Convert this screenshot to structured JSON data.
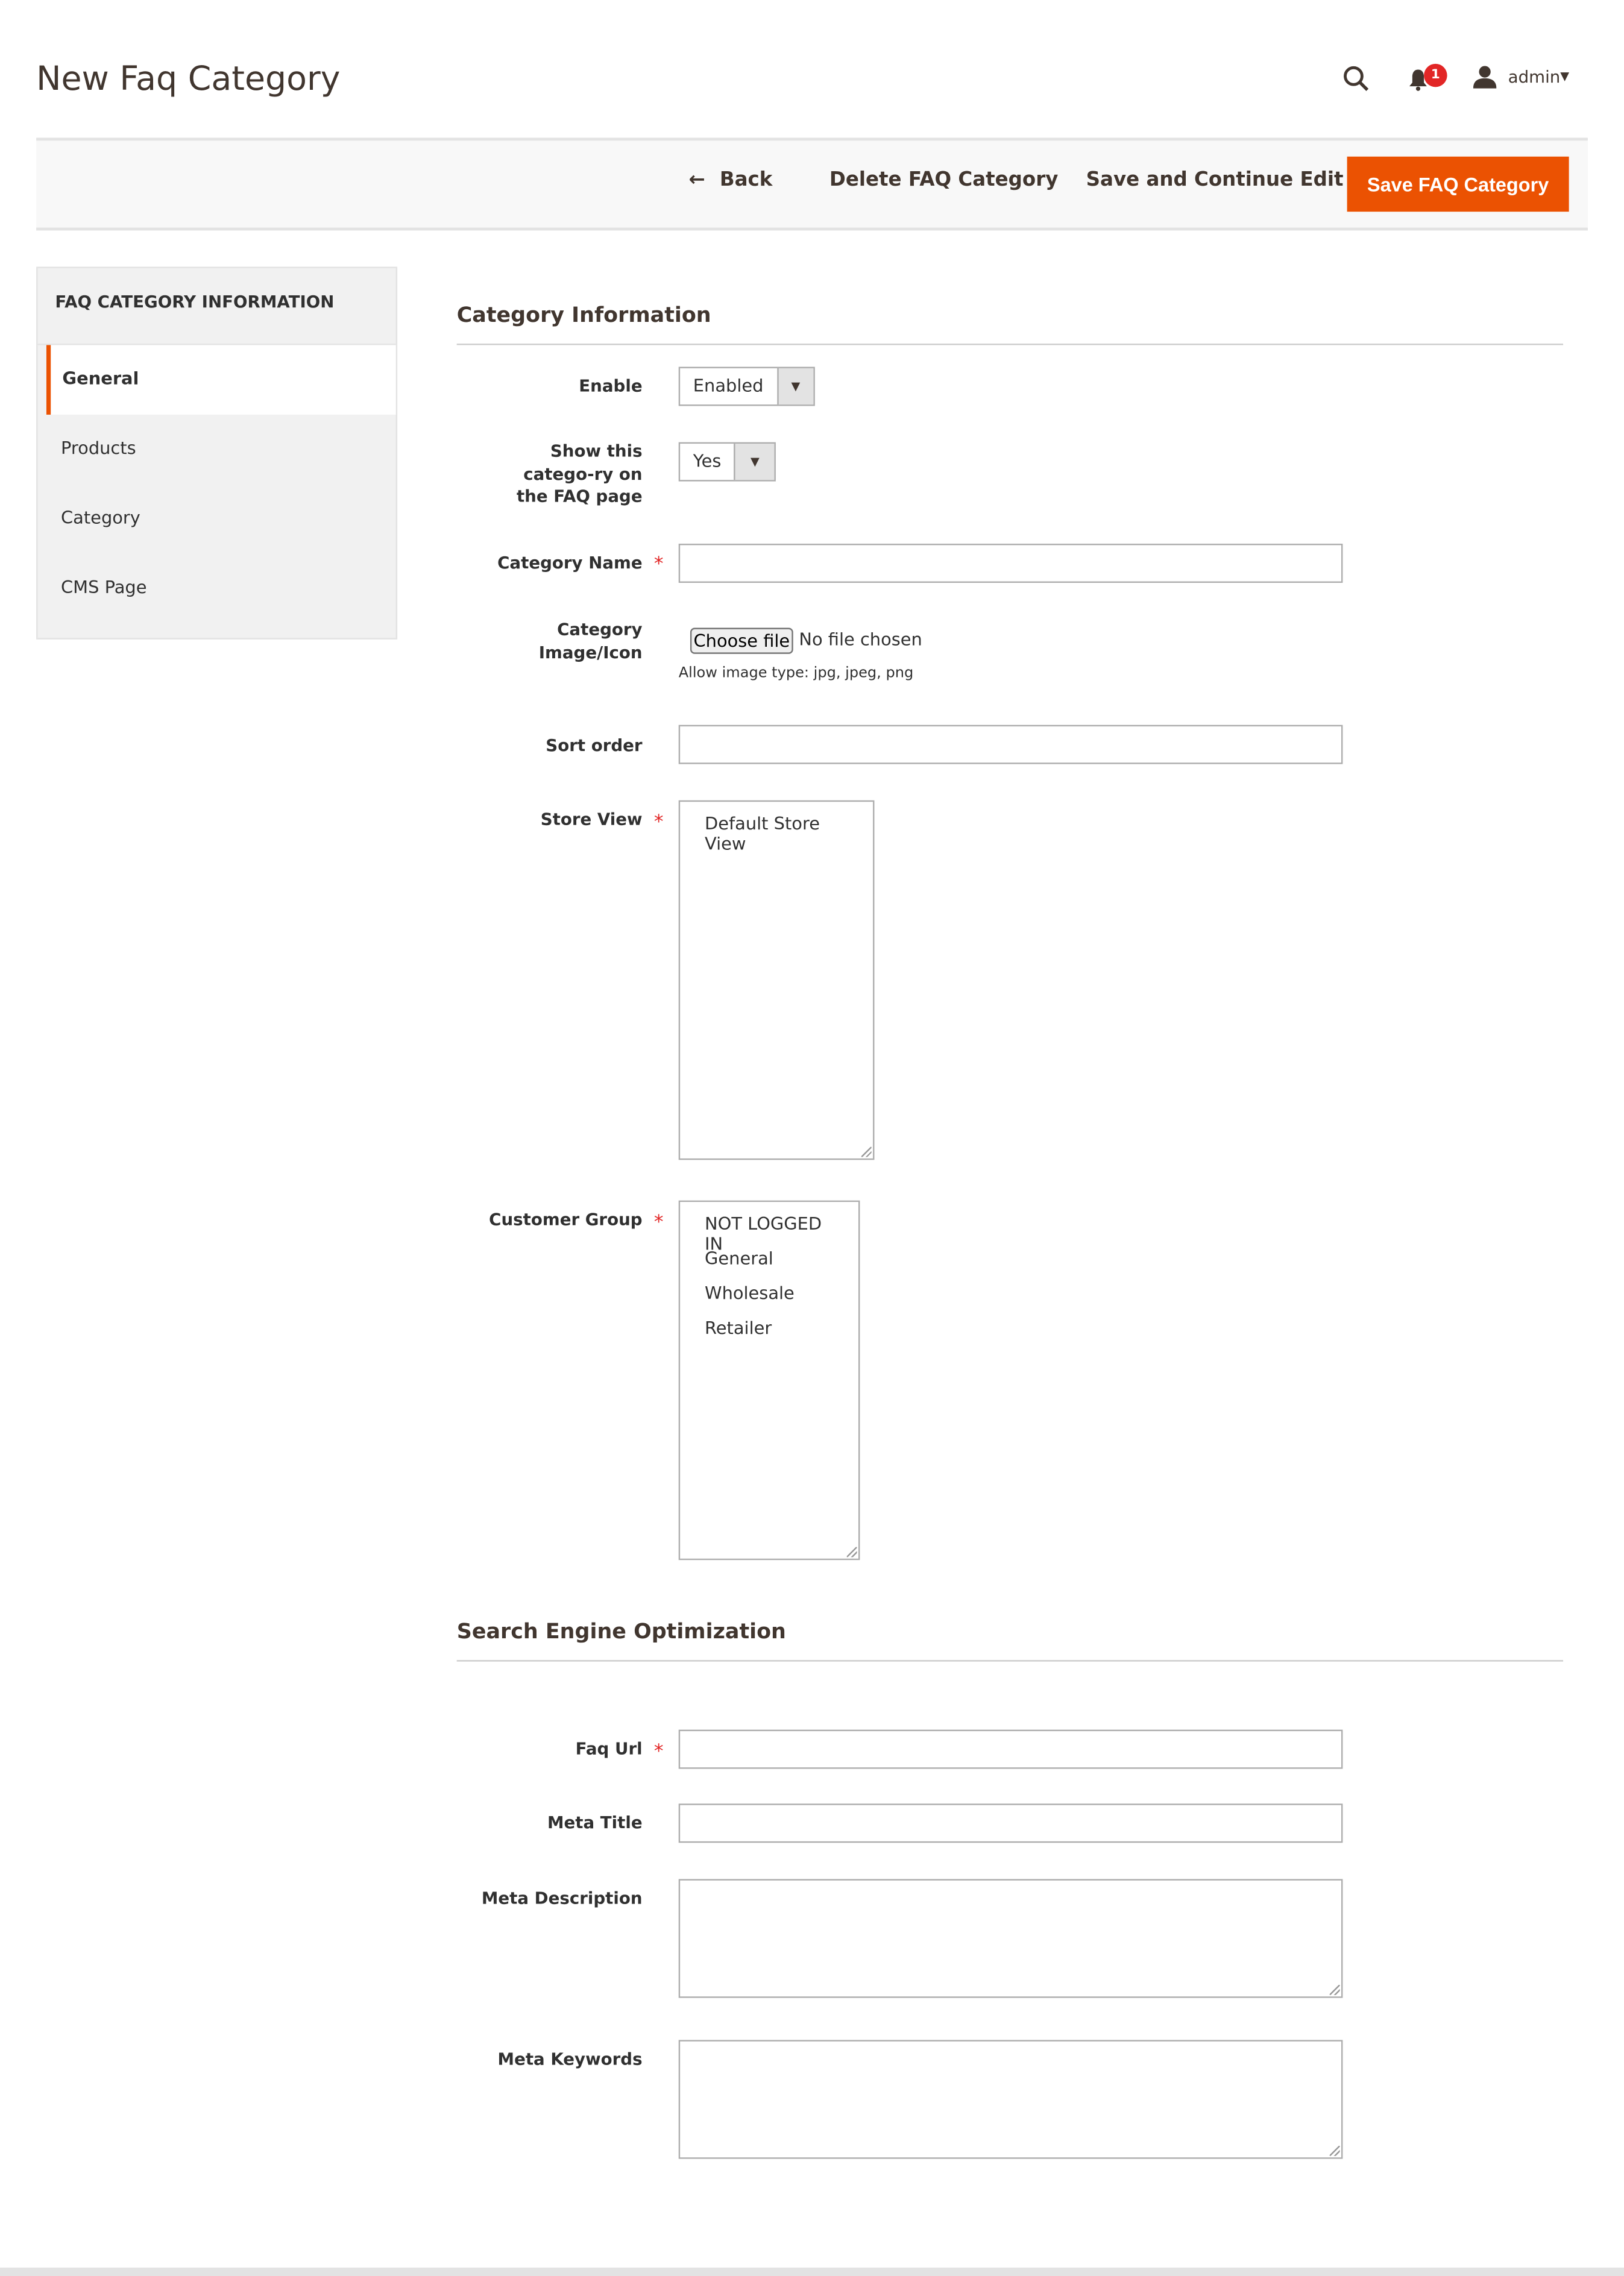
{
  "page": {
    "title": "New Faq Category"
  },
  "header": {
    "user": "admin",
    "notifications": "1",
    "icons": [
      "search-icon",
      "bell-icon",
      "user-icon",
      "caret-down-icon"
    ]
  },
  "toolbar": {
    "back": "Back",
    "delete": "Delete FAQ Category",
    "save_continue": "Save and Continue Edit",
    "save": "Save FAQ Category",
    "accent": "#eb5202"
  },
  "sidebar": {
    "heading": "FAQ CATEGORY INFORMATION",
    "items": [
      {
        "label": "General",
        "active": true
      },
      {
        "label": "Products"
      },
      {
        "label": "Category"
      },
      {
        "label": "CMS Page"
      }
    ]
  },
  "sections": {
    "info": {
      "title": "Category Information",
      "enable": {
        "label": "Enable",
        "value": "Enabled"
      },
      "show": {
        "label": "Show this catego-ry on the FAQ page",
        "value": "Yes"
      },
      "name": {
        "label": "Category Name",
        "value": ""
      },
      "image": {
        "label": "Category Image/Icon",
        "button": "Choose file",
        "status": "No file chosen",
        "note": "Allow image type: jpg, jpeg, png"
      },
      "sort": {
        "label": "Sort order",
        "value": ""
      },
      "store": {
        "label": "Store View",
        "options": [
          "Default Store View"
        ]
      },
      "group": {
        "label": "Customer Group",
        "options": [
          "NOT LOGGED IN",
          "General",
          "Wholesale",
          "Retailer"
        ]
      }
    },
    "seo": {
      "title": "Search Engine Optimization",
      "url": {
        "label": "Faq Url",
        "value": ""
      },
      "meta_title": {
        "label": "Meta Title",
        "value": ""
      },
      "meta_desc": {
        "label": "Meta Description",
        "value": ""
      },
      "meta_kw": {
        "label": "Meta Keywords",
        "value": ""
      }
    }
  },
  "required_mark": "*"
}
